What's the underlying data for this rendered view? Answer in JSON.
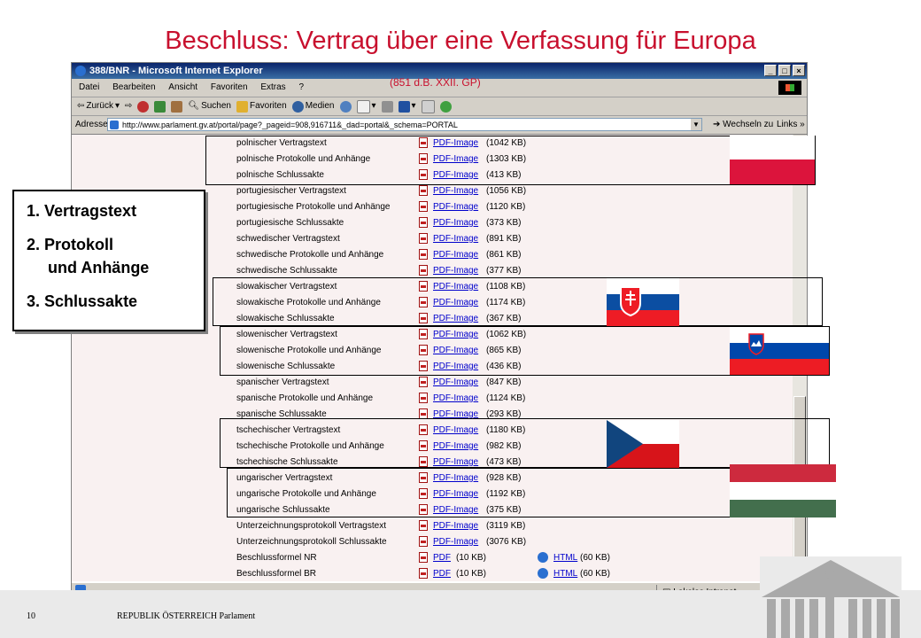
{
  "slide": {
    "title": "Beschluss:  Vertrag über eine Verfassung für Europa",
    "subtitle": "(851 d.B. XXII. GP)",
    "footer_page": "10",
    "footer_text": "REPUBLIK ÖSTERREICH Parlament"
  },
  "browser": {
    "window_title": "388/BNR - Microsoft Internet Explorer",
    "menu": [
      "Datei",
      "Bearbeiten",
      "Ansicht",
      "Favoriten",
      "Extras",
      "?"
    ],
    "toolbar": {
      "back": "Zurück",
      "search": "Suchen",
      "favorites": "Favoriten",
      "media": "Medien"
    },
    "address_label": "Adresse",
    "address_url": "http://www.parlament.gv.at/portal/page?_pageid=908,916711&_dad=portal&_schema=PORTAL",
    "go_label": "Wechseln zu",
    "links_label": "Links",
    "status_zone": "Lokales Intranet"
  },
  "rows": [
    {
      "label": "polnischer Vertragstext",
      "link": "PDF-Image",
      "size": "(1042 KB)"
    },
    {
      "label": "polnische Protokolle und Anhänge",
      "link": "PDF-Image",
      "size": "(1303 KB)"
    },
    {
      "label": "polnische Schlussakte",
      "link": "PDF-Image",
      "size": "(413 KB)"
    },
    {
      "label": "portugiesischer Vertragstext",
      "link": "PDF-Image",
      "size": "(1056 KB)"
    },
    {
      "label": "portugiesische Protokolle und Anhänge",
      "link": "PDF-Image",
      "size": "(1120 KB)"
    },
    {
      "label": "portugiesische Schlussakte",
      "link": "PDF-Image",
      "size": "(373 KB)"
    },
    {
      "label": "schwedischer Vertragstext",
      "link": "PDF-Image",
      "size": "(891 KB)"
    },
    {
      "label": "schwedische Protokolle und Anhänge",
      "link": "PDF-Image",
      "size": "(861 KB)"
    },
    {
      "label": "schwedische Schlussakte",
      "link": "PDF-Image",
      "size": "(377 KB)"
    },
    {
      "label": "slowakischer Vertragstext",
      "link": "PDF-Image",
      "size": "(1108 KB)"
    },
    {
      "label": "slowakische Protokolle und Anhänge",
      "link": "PDF-Image",
      "size": "(1174 KB)"
    },
    {
      "label": "slowakische Schlussakte",
      "link": "PDF-Image",
      "size": "(367 KB)"
    },
    {
      "label": "slowenischer Vertragstext",
      "link": "PDF-Image",
      "size": "(1062 KB)"
    },
    {
      "label": "slowenische Protokolle und Anhänge",
      "link": "PDF-Image",
      "size": "(865 KB)"
    },
    {
      "label": "slowenische Schlussakte",
      "link": "PDF-Image",
      "size": "(436 KB)"
    },
    {
      "label": "spanischer Vertragstext",
      "link": "PDF-Image",
      "size": "(847 KB)"
    },
    {
      "label": "spanische Protokolle und Anhänge",
      "link": "PDF-Image",
      "size": "(1124 KB)"
    },
    {
      "label": "spanische Schlussakte",
      "link": "PDF-Image",
      "size": "(293 KB)"
    },
    {
      "label": "tschechischer Vertragstext",
      "link": "PDF-Image",
      "size": "(1180 KB)"
    },
    {
      "label": "tschechische Protokolle und Anhänge",
      "link": "PDF-Image",
      "size": "(982 KB)"
    },
    {
      "label": "tschechische Schlussakte",
      "link": "PDF-Image",
      "size": "(473 KB)"
    },
    {
      "label": "ungarischer Vertragstext",
      "link": "PDF-Image",
      "size": "(928 KB)"
    },
    {
      "label": "ungarische Protokolle und Anhänge",
      "link": "PDF-Image",
      "size": "(1192 KB)"
    },
    {
      "label": "ungarische Schlussakte",
      "link": "PDF-Image",
      "size": "(375 KB)"
    },
    {
      "label": "Unterzeichnungsprotokoll Vertragstext",
      "link": "PDF-Image",
      "size": "(3119 KB)"
    },
    {
      "label": "Unterzeichnungsprotokoll Schlussakte",
      "link": "PDF-Image",
      "size": "(3076 KB)"
    },
    {
      "label": "Beschlussformel NR",
      "link": "PDF",
      "size": "(10 KB)",
      "html_link": "HTML",
      "html_size": "(60 KB)"
    },
    {
      "label": "Beschlussformel BR",
      "link": "PDF",
      "size": "(10 KB)",
      "html_link": "HTML",
      "html_size": "(60 KB)"
    }
  ],
  "legend": {
    "item1": "1. Vertragstext",
    "item2a": "2. Protokoll",
    "item2b": "und Anhänge",
    "item3": "3. Schlussakte"
  },
  "colors": {
    "title_red": "#c8102e",
    "link_blue": "#0000cc",
    "content_bg": "#f9f1f1"
  }
}
